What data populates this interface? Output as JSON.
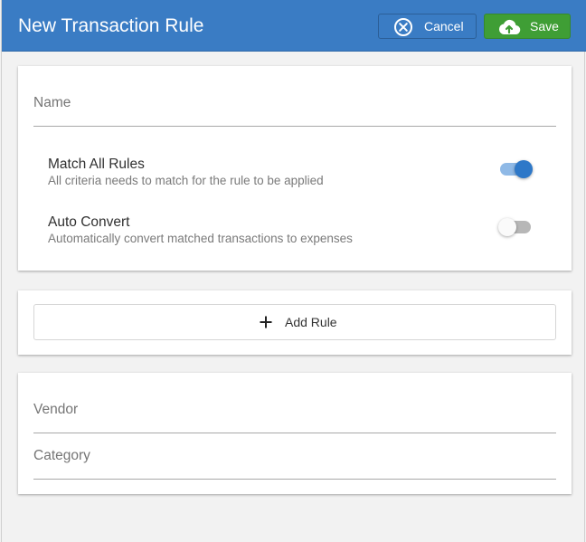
{
  "header": {
    "title": "New Transaction Rule",
    "cancel_label": "Cancel",
    "save_label": "Save",
    "cancel_icon": "circle-x-icon",
    "save_icon": "cloud-upload-icon",
    "bar_color": "#3a7cc4",
    "save_color": "#3f9e35"
  },
  "rule_form": {
    "name": {
      "label": "Name",
      "value": ""
    },
    "options": [
      {
        "title": "Match All Rules",
        "description": "All criteria needs to match for the rule to be applied",
        "enabled": true
      },
      {
        "title": "Auto Convert",
        "description": "Automatically convert matched transactions to expenses",
        "enabled": false
      }
    ]
  },
  "rules": {
    "add_label": "Add Rule",
    "add_icon": "plus-icon"
  },
  "target": {
    "vendor": {
      "label": "Vendor",
      "value": ""
    },
    "category": {
      "label": "Category",
      "value": ""
    }
  }
}
